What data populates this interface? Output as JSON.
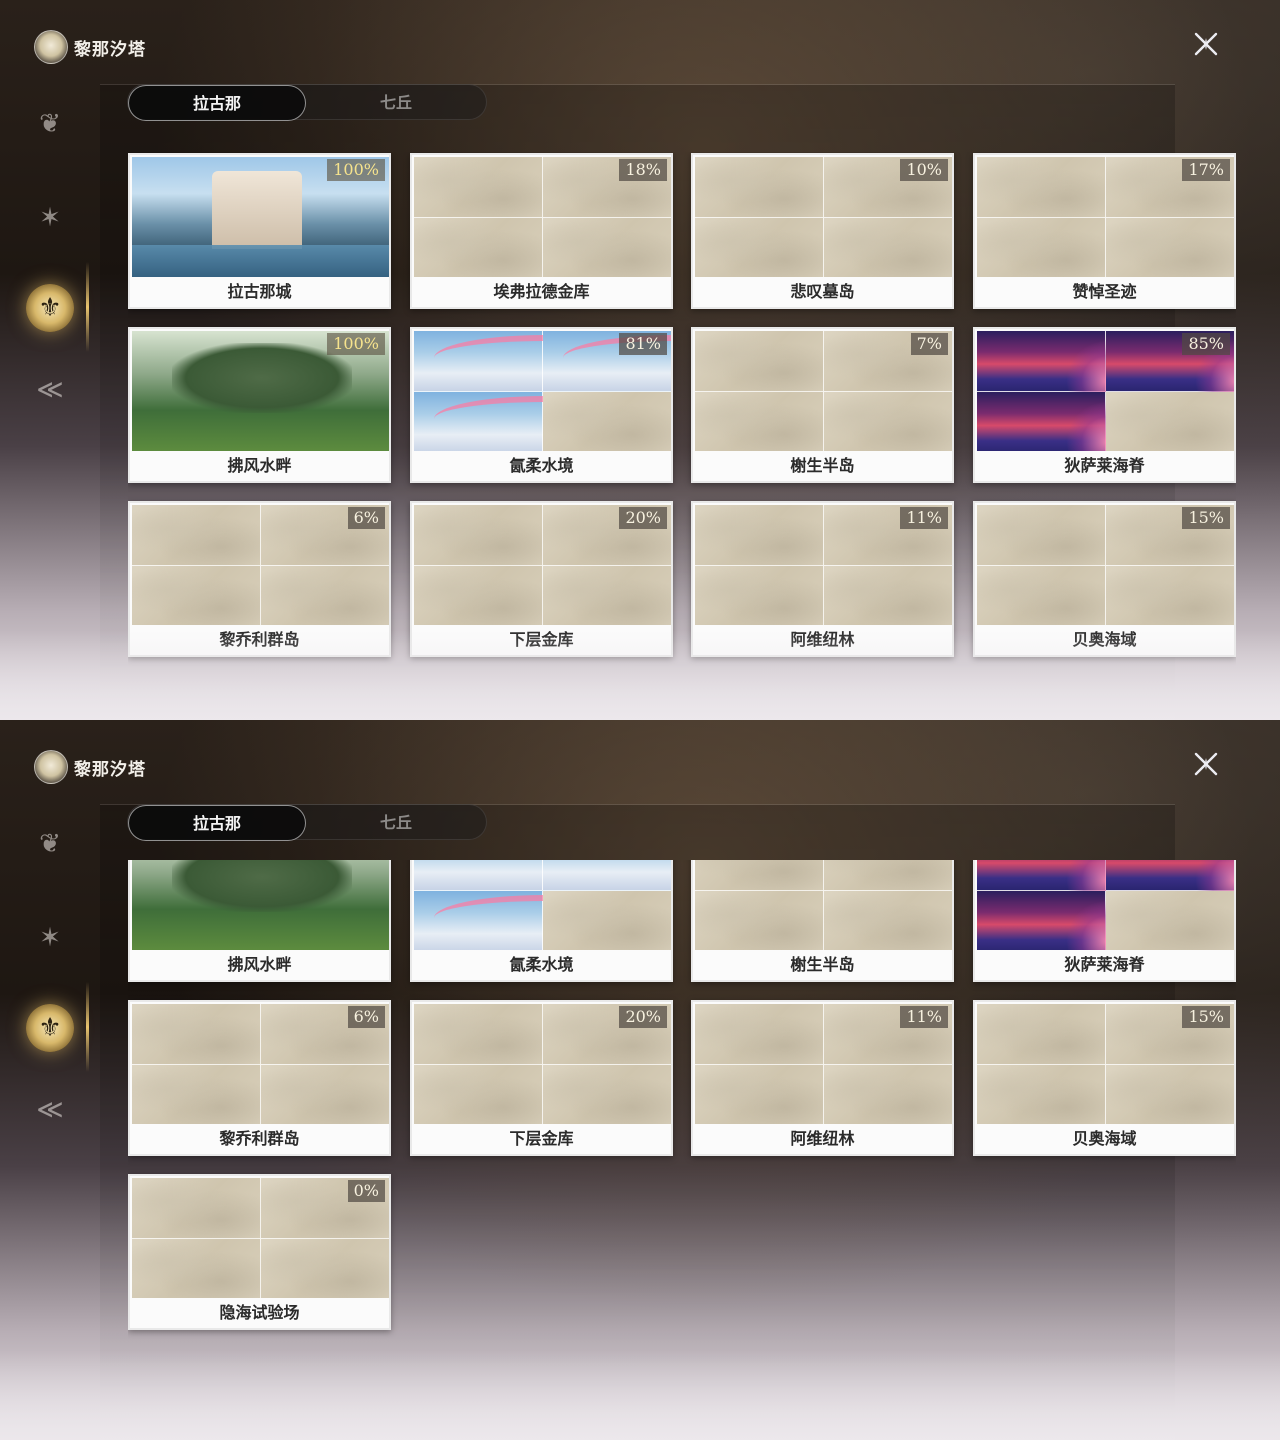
{
  "header": {
    "title": "黎那汐塔",
    "brand_icon": "region-emblem-icon",
    "close_icon": "close-icon"
  },
  "side_nav": {
    "items": [
      {
        "icon": "lotus-emblem-icon",
        "active": false
      },
      {
        "icon": "star-emblem-icon",
        "active": false
      },
      {
        "icon": "region-emblem-icon",
        "active": true
      },
      {
        "icon": "wing-emblem-icon",
        "active": false
      }
    ],
    "accent_color": "#e9c46f"
  },
  "tabs": [
    {
      "label": "拉古那",
      "active": true
    },
    {
      "label": "七丘",
      "active": false
    }
  ],
  "regions": [
    {
      "name": "拉古那城",
      "progress": "100%",
      "art": "city",
      "complete": true
    },
    {
      "name": "埃弗拉德金库",
      "progress": "18%",
      "art": "none",
      "complete": false
    },
    {
      "name": "悲叹墓岛",
      "progress": "10%",
      "art": "none",
      "complete": false
    },
    {
      "name": "赞悼圣迹",
      "progress": "17%",
      "art": "none",
      "complete": false
    },
    {
      "name": "拂风水畔",
      "progress": "100%",
      "art": "meadow",
      "complete": true
    },
    {
      "name": "氤柔水境",
      "progress": "81%",
      "art": "sky",
      "complete": false
    },
    {
      "name": "榭生半岛",
      "progress": "7%",
      "art": "none",
      "complete": false
    },
    {
      "name": "狄萨莱海脊",
      "progress": "85%",
      "art": "nebula",
      "complete": false
    },
    {
      "name": "黎乔利群岛",
      "progress": "6%",
      "art": "none",
      "complete": false
    },
    {
      "name": "下层金库",
      "progress": "20%",
      "art": "none",
      "complete": false
    },
    {
      "name": "阿维纽林",
      "progress": "11%",
      "art": "none",
      "complete": false
    },
    {
      "name": "贝奥海域",
      "progress": "15%",
      "art": "none",
      "complete": false
    },
    {
      "name": "隐海试验场",
      "progress": "0%",
      "art": "none",
      "complete": false
    }
  ],
  "colors": {
    "card_bg": "#fbfbfb",
    "map_tint": "#d6cdb8",
    "progress_complete": "#f6e38d",
    "progress_text": "#f7f1df"
  }
}
